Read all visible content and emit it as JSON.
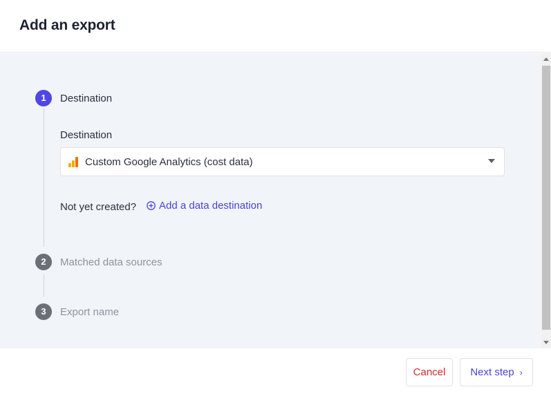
{
  "dialog": {
    "title": "Add an export"
  },
  "steps": [
    {
      "number": "1",
      "label": "Destination",
      "state": "active"
    },
    {
      "number": "2",
      "label": "Matched data sources",
      "state": "inactive"
    },
    {
      "number": "3",
      "label": "Export name",
      "state": "inactive"
    }
  ],
  "destination": {
    "field_label": "Destination",
    "selected_value": "Custom Google Analytics (cost data)",
    "selected_icon": "google-analytics-icon",
    "hint_text": "Not yet created?",
    "add_link_label": "Add a data destination",
    "add_link_icon": "plus-circle-icon"
  },
  "footer": {
    "cancel_label": "Cancel",
    "next_label": "Next step",
    "next_icon": "chevron-right-icon"
  },
  "colors": {
    "accent": "#4f46e5",
    "link": "#4a43d6",
    "danger": "#d52a2a",
    "panel_bg": "#f1f4f9",
    "inactive_step": "#6b6f76"
  }
}
